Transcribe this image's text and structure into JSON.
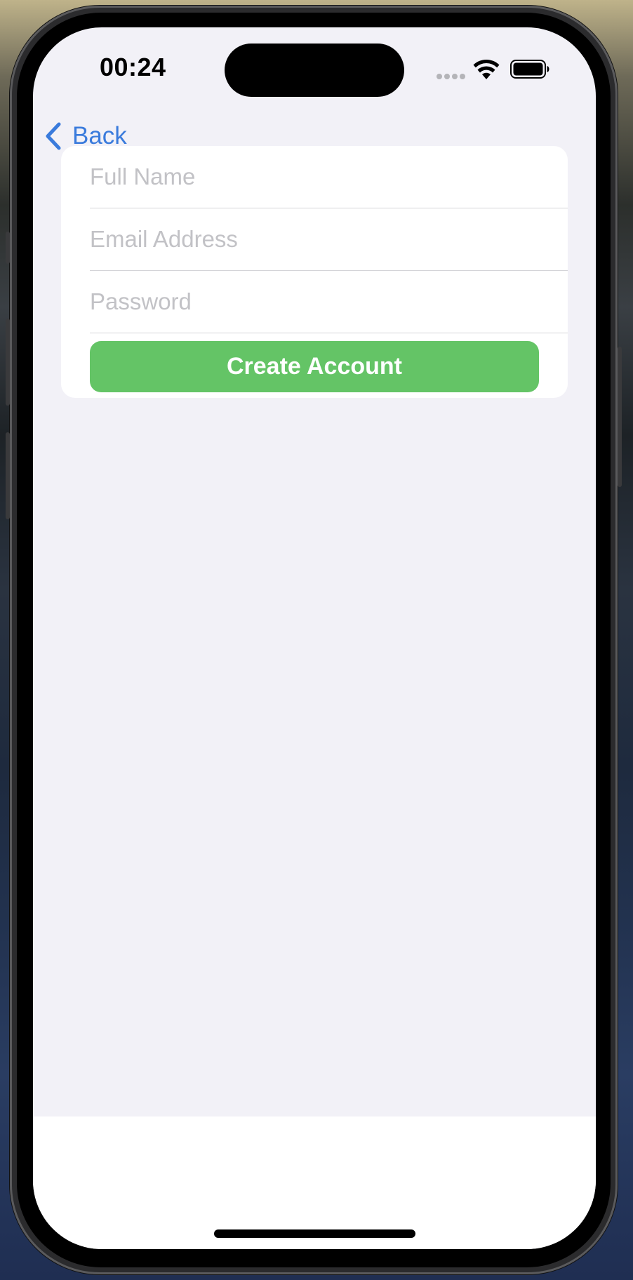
{
  "status_bar": {
    "time": "00:24",
    "icons": [
      "cellular-signal-icon",
      "wifi-icon",
      "battery-icon"
    ]
  },
  "nav": {
    "back_label": "Back",
    "back_icon": "chevron-left-icon"
  },
  "form": {
    "fields": [
      {
        "placeholder": "Full Name",
        "value": ""
      },
      {
        "placeholder": "Email Address",
        "value": ""
      },
      {
        "placeholder": "Password",
        "value": ""
      }
    ],
    "submit_label": "Create Account"
  },
  "colors": {
    "accent": "#3a7bdc",
    "button": "#64c466",
    "background": "#f2f1f7",
    "card": "#ffffff"
  }
}
